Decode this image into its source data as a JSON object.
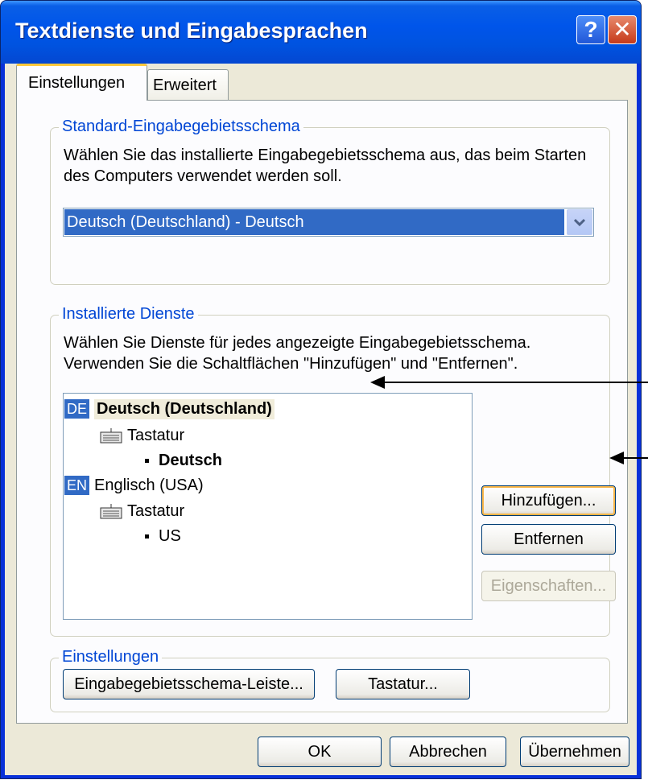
{
  "window": {
    "title": "Textdienste und Eingabesprachen",
    "help_glyph": "?",
    "close_glyph": "✕"
  },
  "tabs": [
    {
      "label": "Einstellungen",
      "active": true
    },
    {
      "label": "Erweitert",
      "active": false
    }
  ],
  "default_group": {
    "label": "Standard-Eingabegebietsschema",
    "description_line1": "Wählen Sie das installierte Eingabegebietsschema aus, das beim Starten",
    "description_line2": "des Computers verwendet werden soll.",
    "combo_value": "Deutsch (Deutschland) - Deutsch"
  },
  "services_group": {
    "label": "Installierte Dienste",
    "description_line1": "Wählen Sie Dienste für jedes angezeigte Eingabegebietsschema.",
    "description_line2": "Verwenden Sie die Schaltflächen \"Hinzufügen\" und \"Entfernen\".",
    "tree": [
      {
        "badge": "DE",
        "language": "Deutsch (Deutschland)",
        "category": "Tastatur",
        "layout": "Deutsch"
      },
      {
        "badge": "EN",
        "language": "Englisch (USA)",
        "category": "Tastatur",
        "layout": "US"
      }
    ],
    "buttons": {
      "add": "Hinzufügen...",
      "remove": "Entfernen",
      "properties": "Eigenschaften..."
    }
  },
  "settings_group": {
    "label": "Einstellungen",
    "language_bar_button": "Eingabegebietsschema-Leiste...",
    "keyboard_button": "Tastatur..."
  },
  "footer": {
    "ok": "OK",
    "cancel": "Abbrechen",
    "apply": "Übernehmen"
  },
  "colors": {
    "titlebar": "#0055ea",
    "selection": "#316ac5",
    "group_label": "#0046d5",
    "focus_ring": "#f8b548"
  },
  "icons": {
    "keyboard": "keyboard-icon",
    "dropdown": "chevron-down-icon"
  }
}
